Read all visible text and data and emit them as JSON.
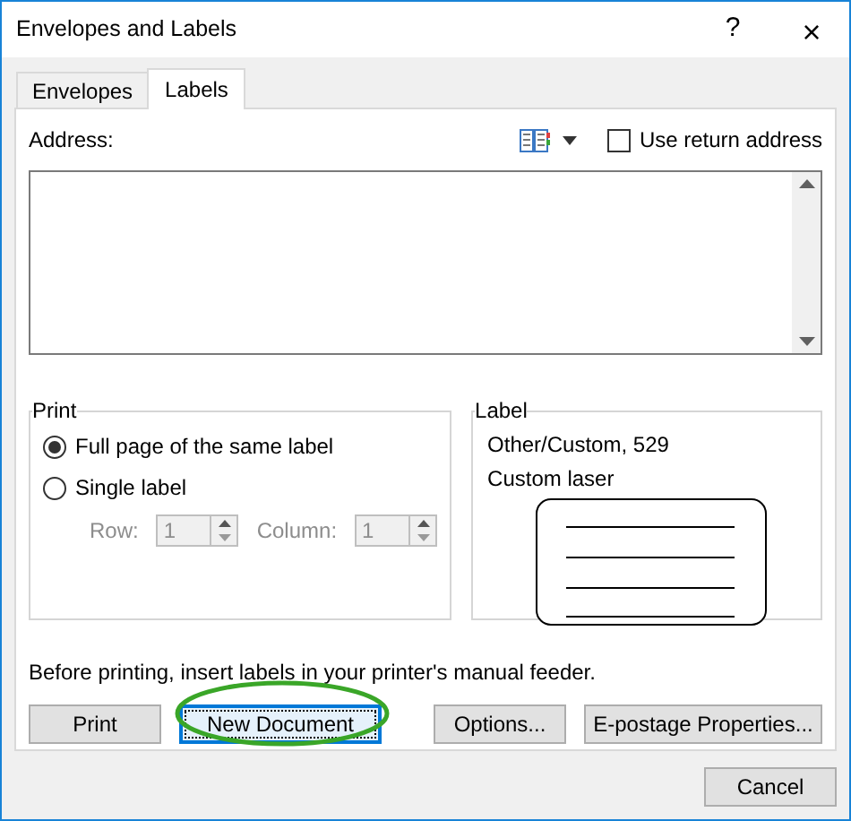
{
  "window": {
    "title": "Envelopes and Labels",
    "help": "?",
    "close": "×"
  },
  "tabs": [
    {
      "label": "Envelopes",
      "selected": false
    },
    {
      "label": "Labels",
      "selected": true
    }
  ],
  "address": {
    "label": "Address:"
  },
  "use_return_address": {
    "label": "Use return address",
    "checked": false
  },
  "print_group": {
    "title": "Print",
    "options": [
      {
        "label": "Full page of the same label",
        "selected": true
      },
      {
        "label": "Single label",
        "selected": false
      }
    ],
    "row": {
      "label": "Row:",
      "value": "1",
      "disabled": true
    },
    "column": {
      "label": "Column:",
      "value": "1",
      "disabled": true
    }
  },
  "label_group": {
    "title": "Label",
    "lines": [
      "Other/Custom, 529",
      "Custom laser"
    ]
  },
  "note": "Before printing, insert labels in your printer's manual feeder.",
  "buttons": [
    {
      "label": "Print",
      "focused": false
    },
    {
      "label": "New Document",
      "focused": true
    },
    {
      "label": "Options...",
      "focused": false
    },
    {
      "label": "E-postage Properties...",
      "focused": false
    }
  ],
  "cancel": "Cancel"
}
